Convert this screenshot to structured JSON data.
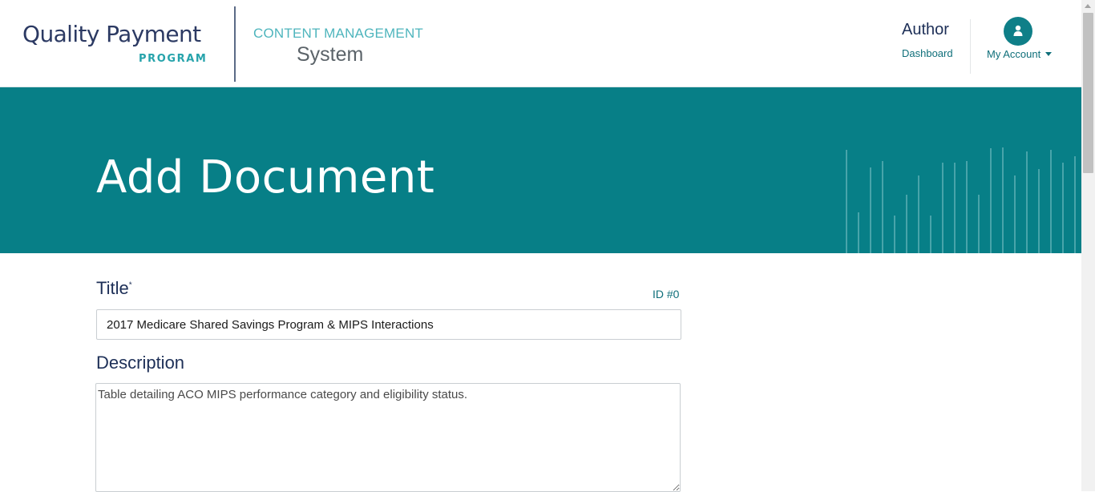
{
  "header": {
    "logo": {
      "line1": "Quality Payment",
      "line2": "PROGRAM"
    },
    "app": {
      "line1": "CONTENT MANAGEMENT",
      "line2": "System"
    },
    "nav": {
      "role": "Author",
      "dashboard_link": "Dashboard",
      "account_label": "My Account",
      "avatar_icon": "user-icon",
      "caret_icon": "caret-down-icon"
    }
  },
  "banner": {
    "title": "Add Document",
    "decoration": "vertical-lines"
  },
  "form": {
    "title_label": "Title",
    "required_marker": "*",
    "doc_id": "ID #0",
    "title_value": "2017 Medicare Shared Savings Program & MIPS Interactions",
    "description_label": "Description",
    "description_value": "Table detailing ACO MIPS performance category and eligibility status."
  },
  "colors": {
    "brand_navy": "#1d2f57",
    "brand_teal": "#077f87",
    "accent_teal": "#26a3ab",
    "link_teal": "#0f6f7a"
  }
}
